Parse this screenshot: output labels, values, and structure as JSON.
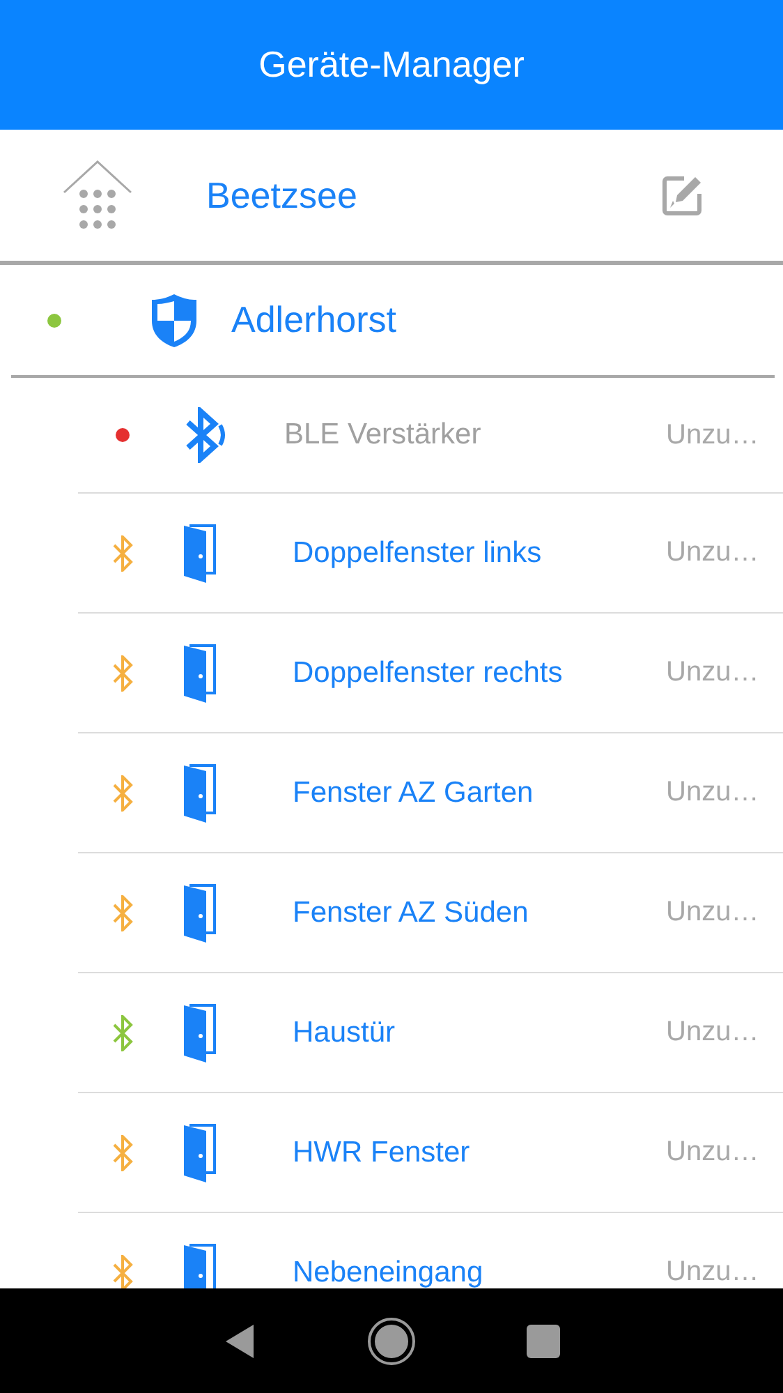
{
  "header": {
    "title": "Geräte-Manager"
  },
  "home": {
    "name": "Beetzsee"
  },
  "group": {
    "name": "Adlerhorst",
    "color": "#8cc63f"
  },
  "devices": [
    {
      "kind": "repeater",
      "name": "BLE Verstärker",
      "status": "Unzu…",
      "color": "#e53030"
    },
    {
      "kind": "door",
      "name": "Doppelfenster links",
      "status": "Unzu…",
      "color": "#f5b041"
    },
    {
      "kind": "door",
      "name": "Doppelfenster rechts",
      "status": "Unzu…",
      "color": "#f5b041"
    },
    {
      "kind": "door",
      "name": "Fenster AZ Garten",
      "status": "Unzu…",
      "color": "#f5b041"
    },
    {
      "kind": "door",
      "name": "Fenster AZ Süden",
      "status": "Unzu…",
      "color": "#f5b041"
    },
    {
      "kind": "door",
      "name": "Haustür",
      "status": "Unzu…",
      "color": "#8cc63f"
    },
    {
      "kind": "door",
      "name": "HWR Fenster",
      "status": "Unzu…",
      "color": "#f5b041"
    },
    {
      "kind": "door",
      "name": "Nebeneingang",
      "status": "Unzu…",
      "color": "#f5b041"
    }
  ]
}
